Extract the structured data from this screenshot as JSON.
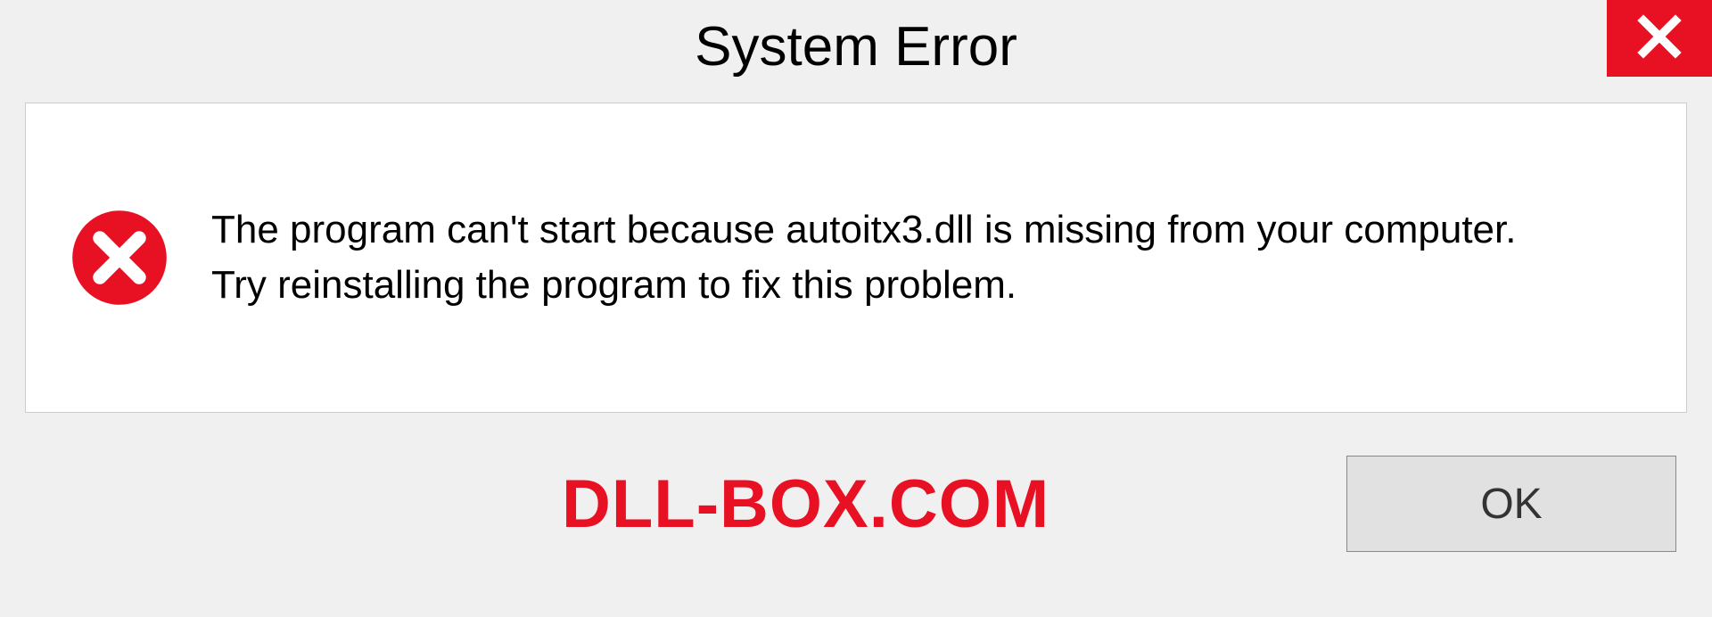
{
  "titlebar": {
    "title": "System Error"
  },
  "dialog": {
    "message_line1": "The program can't start because autoitx3.dll is missing from your computer.",
    "message_line2": "Try reinstalling the program to fix this problem."
  },
  "footer": {
    "brand": "DLL-BOX.COM",
    "ok_label": "OK"
  },
  "colors": {
    "accent_red": "#e81123",
    "panel_bg": "#ffffff",
    "window_bg": "#f0f0f0",
    "button_bg": "#e1e1e1"
  },
  "icons": {
    "close": "close-icon",
    "error": "error-circle-x-icon"
  }
}
